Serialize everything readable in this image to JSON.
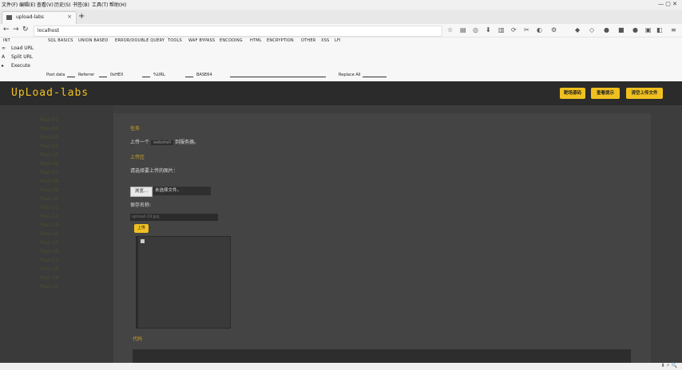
{
  "menubar": {
    "items": [
      "文件(F)",
      "编辑(E)",
      "查看(V)",
      "历史(S)",
      "书签(B)",
      "工具(T)",
      "帮助(H)"
    ],
    "window_controls": "— ▢ ✕"
  },
  "tab": {
    "title": "upload-labs",
    "close": "×",
    "new_tab": "+"
  },
  "nav": {
    "back": "←",
    "forward": "→",
    "reload": "↻",
    "url": "localhost"
  },
  "hackbar": {
    "menu": [
      "INT",
      "SQL BASICS",
      "UNION BASED",
      "ERROR/DOUBLE QUERY",
      "TOOLS",
      "WAF BYPASS",
      "ENCODING",
      "HTML",
      "ENCRYPTION",
      "OTHER",
      "XSS",
      "LFI"
    ],
    "load_url": "Load URL",
    "split_url": "Split URL",
    "execute": "Execute",
    "options": [
      "Post data",
      "Referrer",
      "0xHEX",
      "%URL",
      "BASE64",
      "Replace All"
    ]
  },
  "site": {
    "logo": "UpLoad-labs",
    "buttons": [
      "靶场源码",
      "查看提示",
      "清空上传文件"
    ],
    "passes": [
      "Pass-01",
      "Pass-02",
      "Pass-03",
      "Pass-04",
      "Pass-05",
      "Pass-06",
      "Pass-07",
      "Pass-08",
      "Pass-09",
      "Pass-10",
      "Pass-11",
      "Pass-12",
      "Pass-13",
      "Pass-14",
      "Pass-15",
      "Pass-16",
      "Pass-17",
      "Pass-18",
      "Pass-19",
      "Pass-20"
    ]
  },
  "panel": {
    "task_heading": "任务",
    "task_text_before": "上传一个",
    "task_code": "webshell",
    "task_text_after": "到服务器。",
    "upload_heading": "上传区",
    "select_label": "请选择要上传的图片：",
    "browse_button": "浏览...",
    "no_file": "未选择文件。",
    "save_label": "保存名称:",
    "save_value": "upload-19.jpg",
    "upload_button": "上传",
    "code_heading": "代码"
  },
  "status": {
    "icons": "⬇ ⚡ 🔍"
  },
  "colors": {
    "accent": "#f0c020",
    "dark_bg": "#2b2b2b"
  }
}
